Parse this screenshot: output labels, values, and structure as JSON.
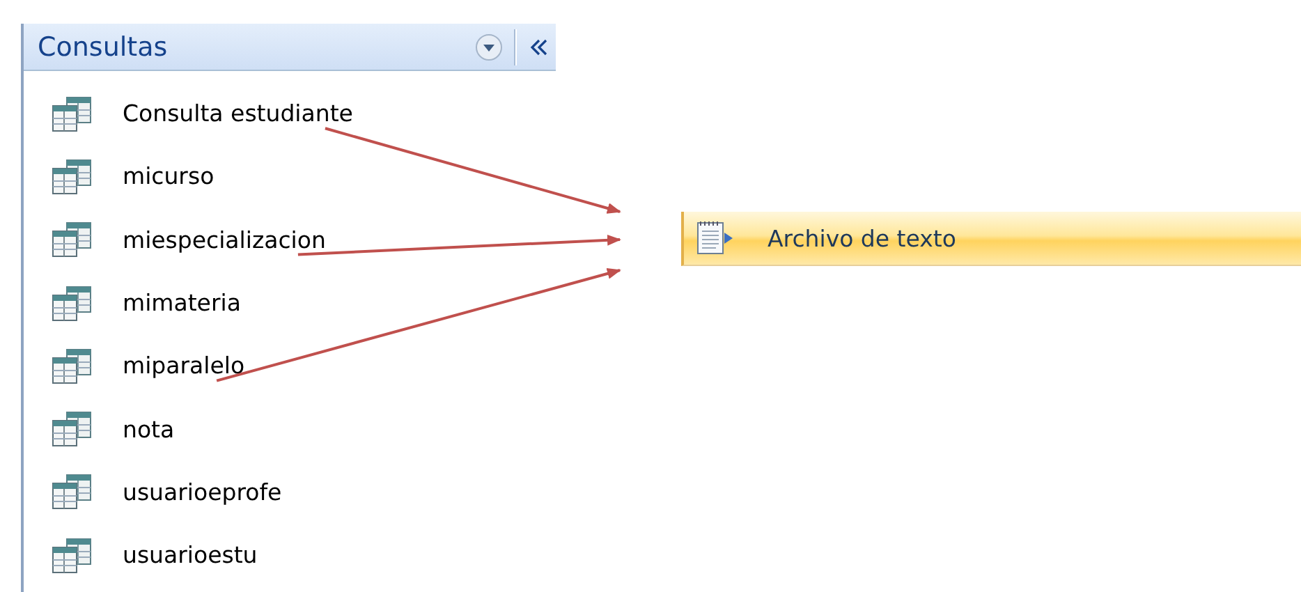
{
  "navigation_pane": {
    "title": "Consultas",
    "items": [
      {
        "label": "Consulta estudiante",
        "arrow": true
      },
      {
        "label": "micurso",
        "arrow": false
      },
      {
        "label": "miespecializacion",
        "arrow": true
      },
      {
        "label": "mimateria",
        "arrow": false
      },
      {
        "label": "miparalelo",
        "arrow": true
      },
      {
        "label": "nota",
        "arrow": false
      },
      {
        "label": "usuarioeprofe",
        "arrow": false
      },
      {
        "label": "usuarioestu",
        "arrow": false
      }
    ]
  },
  "menu_item": {
    "label": "Archivo de texto",
    "highlighted": true
  }
}
